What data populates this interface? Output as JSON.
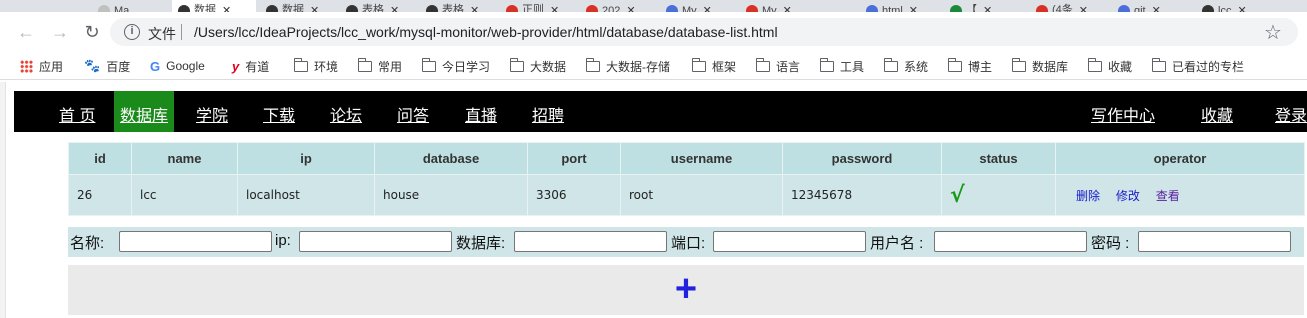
{
  "browser": {
    "tabs": [
      {
        "label": "Ma",
        "color": "#c0c0c0"
      },
      {
        "label": "数据",
        "color": "#333333",
        "active": true
      },
      {
        "label": "数据",
        "color": "#333333"
      },
      {
        "label": "表格",
        "color": "#333333"
      },
      {
        "label": "表格",
        "color": "#333333"
      },
      {
        "label": "正则",
        "color": "#d93025"
      },
      {
        "label": "202",
        "color": "#d93025"
      },
      {
        "label": "My",
        "color": "#4a6fd8"
      },
      {
        "label": "My",
        "color": "#d93025"
      },
      {
        "label": "html",
        "color": "#4a6fd8"
      },
      {
        "label": "【",
        "color": "#1a8a3a"
      },
      {
        "label": "(4条",
        "color": "#d93025"
      },
      {
        "label": "git",
        "color": "#4a6fd8"
      },
      {
        "label": "lcc",
        "color": "#333333"
      }
    ],
    "address": {
      "scheme_label": "文件",
      "url": "/Users/lcc/IdeaProjects/lcc_work/mysql-monitor/web-provider/html/database/database-list.html"
    },
    "bookmarks": [
      {
        "label": "应用",
        "icon": "apps-grid-icon"
      },
      {
        "label": "百度",
        "icon": "baidu-paw-icon"
      },
      {
        "label": "Google",
        "icon": "google-icon"
      },
      {
        "label": "有道",
        "icon": "youdao-icon"
      },
      {
        "label": "环境",
        "icon": "folder-icon"
      },
      {
        "label": "常用",
        "icon": "folder-icon"
      },
      {
        "label": "今日学习",
        "icon": "folder-icon"
      },
      {
        "label": "大数据",
        "icon": "folder-icon"
      },
      {
        "label": "大数据-存储",
        "icon": "folder-icon"
      },
      {
        "label": "框架",
        "icon": "folder-icon"
      },
      {
        "label": "语言",
        "icon": "folder-icon"
      },
      {
        "label": "工具",
        "icon": "folder-icon"
      },
      {
        "label": "系统",
        "icon": "folder-icon"
      },
      {
        "label": "博主",
        "icon": "folder-icon"
      },
      {
        "label": "数据库",
        "icon": "folder-icon"
      },
      {
        "label": "收藏",
        "icon": "folder-icon"
      },
      {
        "label": "已看过的专栏",
        "icon": "folder-icon"
      }
    ]
  },
  "nav": {
    "left": [
      "首 页",
      "数据库",
      "学院",
      "下载",
      "论坛",
      "问答",
      "直播",
      "招聘"
    ],
    "active_index": 1,
    "right": [
      "写作中心",
      "收藏",
      "登录"
    ],
    "active_color": "#1a8a1a"
  },
  "table": {
    "headers": [
      "id",
      "name",
      "ip",
      "database",
      "port",
      "username",
      "password",
      "status",
      "operator"
    ],
    "rows": [
      {
        "id": "26",
        "name": "lcc",
        "ip": "localhost",
        "database": "house",
        "port": "3306",
        "username": "root",
        "password": "12345678",
        "status": "√",
        "operations": [
          "删除",
          "修改",
          "查看"
        ]
      }
    ]
  },
  "form": {
    "fields": [
      {
        "label": "名称:",
        "value": ""
      },
      {
        "label": "ip:",
        "value": ""
      },
      {
        "label": "数据库:",
        "value": ""
      },
      {
        "label": "端口:",
        "value": ""
      },
      {
        "label": "用户名 :",
        "value": ""
      },
      {
        "label": "密码 :",
        "value": ""
      }
    ]
  },
  "add_button_label": "+"
}
